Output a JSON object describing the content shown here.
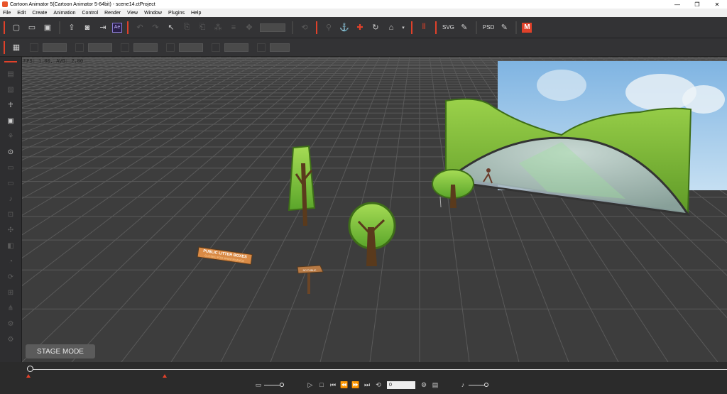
{
  "window": {
    "title": "Cartoon Animator 5(Cartoon Animator 5-64bit) - scene14.ctProject",
    "controls": [
      "—",
      "❐",
      "✕"
    ]
  },
  "menu": [
    "File",
    "Edit",
    "Create",
    "Animation",
    "Control",
    "Render",
    "View",
    "Window",
    "Plugins",
    "Help"
  ],
  "toolbar": {
    "ae_label": "Ae",
    "svg_label": "SVG",
    "psd_label": "PSD",
    "m_label": "M",
    "icons": [
      "new-file-icon",
      "open-folder-icon",
      "save-icon",
      "export-icon",
      "preview-icon",
      "render-icon",
      "undo-icon",
      "redo-icon",
      "select-icon",
      "move-icon",
      "rotate-icon",
      "home-icon"
    ]
  },
  "viewport": {
    "fps": "FPS: 1.00, AVG: 2.00",
    "stage_mode": "STAGE MODE",
    "sign_text_1": "PUBLIC LITTER BOXES",
    "sign_text_2": "CLOSED FOR MAINTENANCE",
    "post_text": "NO PUBLIC"
  },
  "timeline": {
    "frame_value": "0",
    "progress": 0
  },
  "colors": {
    "accent": "#e0412a",
    "grid_bg": "#3d3d3d",
    "grid_line": "#5a5a5a",
    "tree_green": "#7ec23a",
    "sky": "#9ec9ea"
  }
}
